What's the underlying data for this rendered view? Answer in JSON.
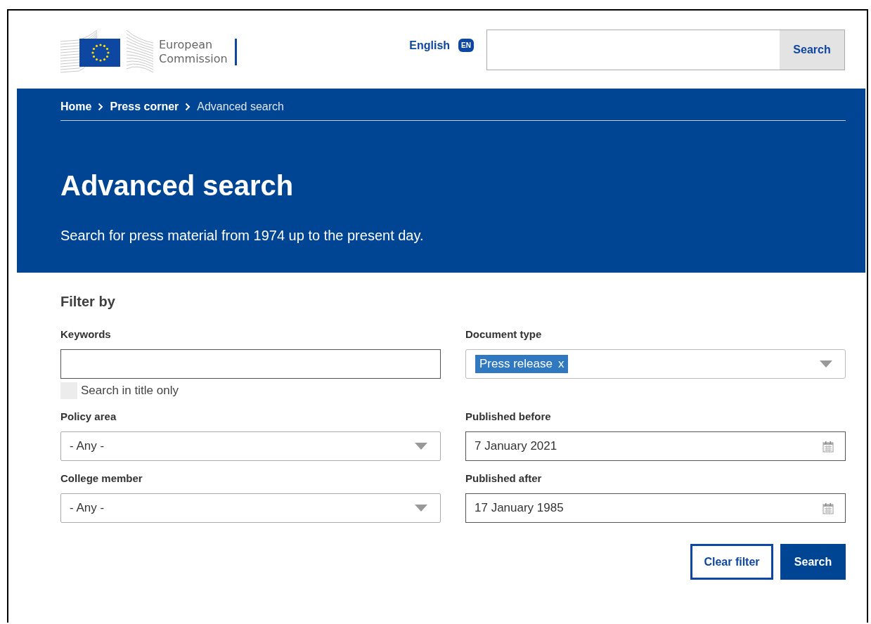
{
  "header": {
    "logo_text": [
      "European",
      "Commission"
    ],
    "language": {
      "label": "English",
      "badge": "EN"
    },
    "search": {
      "button": "Search"
    }
  },
  "breadcrumb": [
    {
      "label": "Home",
      "current": false
    },
    {
      "label": "Press corner",
      "current": false
    },
    {
      "label": "Advanced search",
      "current": true
    }
  ],
  "banner": {
    "title": "Advanced search",
    "intro": "Search for press material from 1974 up to the present day."
  },
  "filter": {
    "heading": "Filter by",
    "fields": [
      {
        "kind": "text",
        "label": "Keywords",
        "option": {
          "label": "Search in title only",
          "checked": false
        }
      },
      {
        "kind": "tags",
        "label": "Document type",
        "tags": [
          {
            "label": "Press release",
            "remove": "x"
          }
        ]
      },
      {
        "kind": "select",
        "label": "Policy area",
        "value": "- Any -"
      },
      {
        "kind": "date",
        "label": "Published before",
        "value": "7 January 2021"
      },
      {
        "kind": "select",
        "label": "College member",
        "value": "- Any -"
      },
      {
        "kind": "date",
        "label": "Published after",
        "value": "17 January 1985"
      }
    ],
    "buttons": [
      {
        "kind": "secondary",
        "label": "Clear filter"
      },
      {
        "kind": "primary",
        "label": "Search"
      }
    ]
  }
}
